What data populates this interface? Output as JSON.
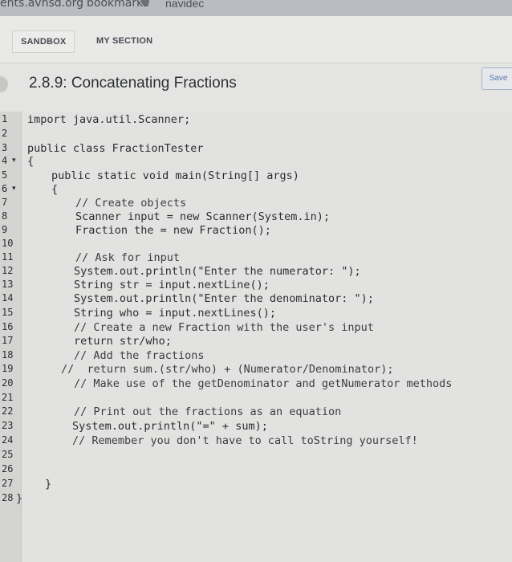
{
  "browser": {
    "url_fragment": "ents.avhsd.org",
    "bookmarks_label": "bookmarks",
    "nav_fragment": "navidec"
  },
  "tabs": [
    {
      "label": "SANDBOX"
    },
    {
      "label": "MY SECTION"
    }
  ],
  "exercise": {
    "title": "2.8.9: Concatenating Fractions",
    "save_label": "Save"
  },
  "editor": {
    "line_numbers": [
      "1",
      "2",
      "3",
      "4",
      "5",
      "6",
      "7",
      "8",
      "9",
      "10",
      "11",
      "12",
      "13",
      "14",
      "15",
      "16",
      "17",
      "18",
      "19",
      "20",
      "21",
      "22",
      "23",
      "24",
      "25",
      "26",
      "27",
      "28"
    ],
    "lines": [
      "import java.util.Scanner;",
      "",
      "public class FractionTester",
      "{",
      "public static void main(String[] args)",
      "{",
      "// Create objects",
      "Scanner input = new Scanner(System.in);",
      "Fraction the = new Fraction();",
      "",
      "// Ask for input",
      "System.out.println(\"Enter the numerator: \");",
      "String str = input.nextLine();",
      "System.out.println(\"Enter the denominator: \");",
      "String who = input.nextLines();",
      "// Create a new Fraction with the user's input",
      "return str/who;",
      "// Add the fractions",
      "//  return sum.(str/who) + (Numerator/Denominator);",
      "// Make use of the getDenominator and getNumerator methods",
      "",
      "// Print out the fractions as an equation",
      "System.out.println(\"=\" + sum);",
      "// Remember you don't have to call toString yourself!",
      "",
      "",
      "}",
      "}"
    ]
  }
}
